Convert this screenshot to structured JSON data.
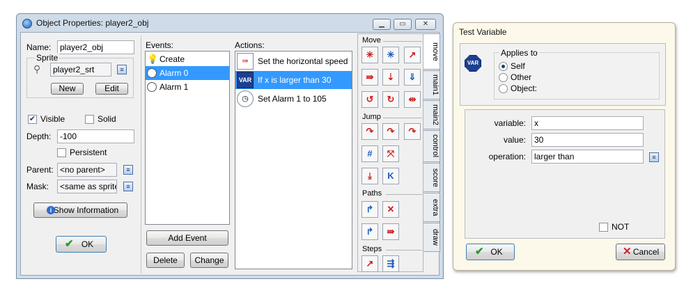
{
  "main": {
    "title": "Object Properties: player2_obj",
    "window_buttons": {
      "minimize": "▁",
      "restore": "▭",
      "close": "✕"
    },
    "name_label": "Name:",
    "name_value": "player2_obj",
    "sprite_group": "Sprite",
    "sprite_value": "player2_srt",
    "new_button": "New",
    "edit_button": "Edit",
    "visible_label": "Visible",
    "visible_checked": true,
    "solid_label": "Solid",
    "solid_checked": false,
    "depth_label": "Depth:",
    "depth_value": "-100",
    "persistent_label": "Persistent",
    "persistent_checked": false,
    "parent_label": "Parent:",
    "parent_value": "<no parent>",
    "mask_label": "Mask:",
    "mask_value": "<same as sprite>",
    "show_info_button": "Show Information",
    "ok_button": "OK",
    "events_label": "Events:",
    "events": [
      {
        "label": "Create",
        "icon": "lightbulb-icon",
        "selected": false
      },
      {
        "label": "Alarm 0",
        "icon": "alarm-clock-icon",
        "selected": true
      },
      {
        "label": "Alarm 1",
        "icon": "alarm-clock-icon",
        "selected": false
      }
    ],
    "add_event_button": "Add Event",
    "delete_button": "Delete",
    "change_button": "Change",
    "actions_label": "Actions:",
    "actions": [
      {
        "label": "Set the horizontal speed",
        "icon": "horizontal-speed-icon",
        "selected": false
      },
      {
        "label": "If x is larger than 30",
        "icon": "var-octagon-icon",
        "selected": true
      },
      {
        "label": "Set Alarm 1 to 105",
        "icon": "alarm-clock-icon",
        "selected": false
      }
    ],
    "palette": {
      "move_group": "Move",
      "jump_group": "Jump",
      "paths_group": "Paths",
      "steps_group": "Steps"
    },
    "tabs": [
      "move",
      "main1",
      "main2",
      "control",
      "score",
      "extra",
      "draw"
    ],
    "active_tab": "move"
  },
  "dialog": {
    "title": "Test Variable",
    "var_icon": "VAR",
    "applies_to_label": "Applies to",
    "applies_self": "Self",
    "applies_other": "Other",
    "applies_object": "Object:",
    "applies_selected": "Self",
    "variable_label": "variable:",
    "variable_value": "x",
    "value_label": "value:",
    "value_value": "30",
    "operation_label": "operation:",
    "operation_value": "larger than",
    "not_label": "NOT",
    "not_checked": false,
    "ok_button": "OK",
    "cancel_button": "Cancel"
  }
}
